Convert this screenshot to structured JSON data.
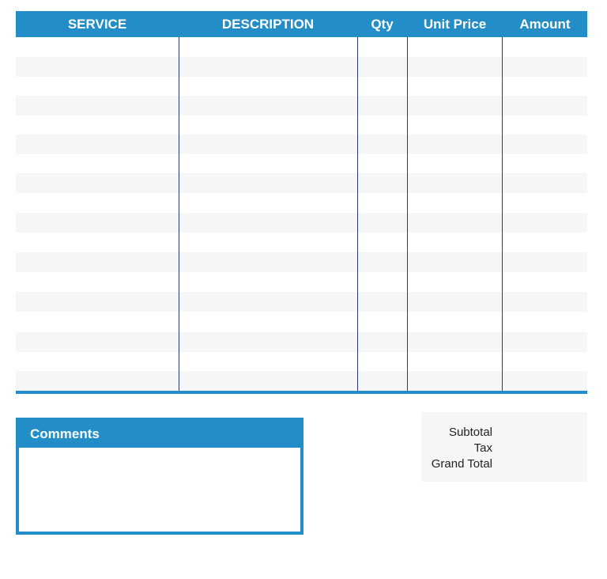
{
  "table": {
    "headers": {
      "service": "SERVICE",
      "description": "DESCRIPTION",
      "qty": "Qty",
      "unit_price": "Unit Price",
      "amount": "Amount"
    },
    "rows": []
  },
  "comments": {
    "title": "Comments",
    "value": ""
  },
  "totals": {
    "subtotal_label": "Subtotal",
    "tax_label": "Tax",
    "grand_total_label": "Grand Total"
  },
  "colors": {
    "accent": "#228dc6",
    "stripe": "#f6f6f6",
    "divider": "#2e3a6e"
  }
}
